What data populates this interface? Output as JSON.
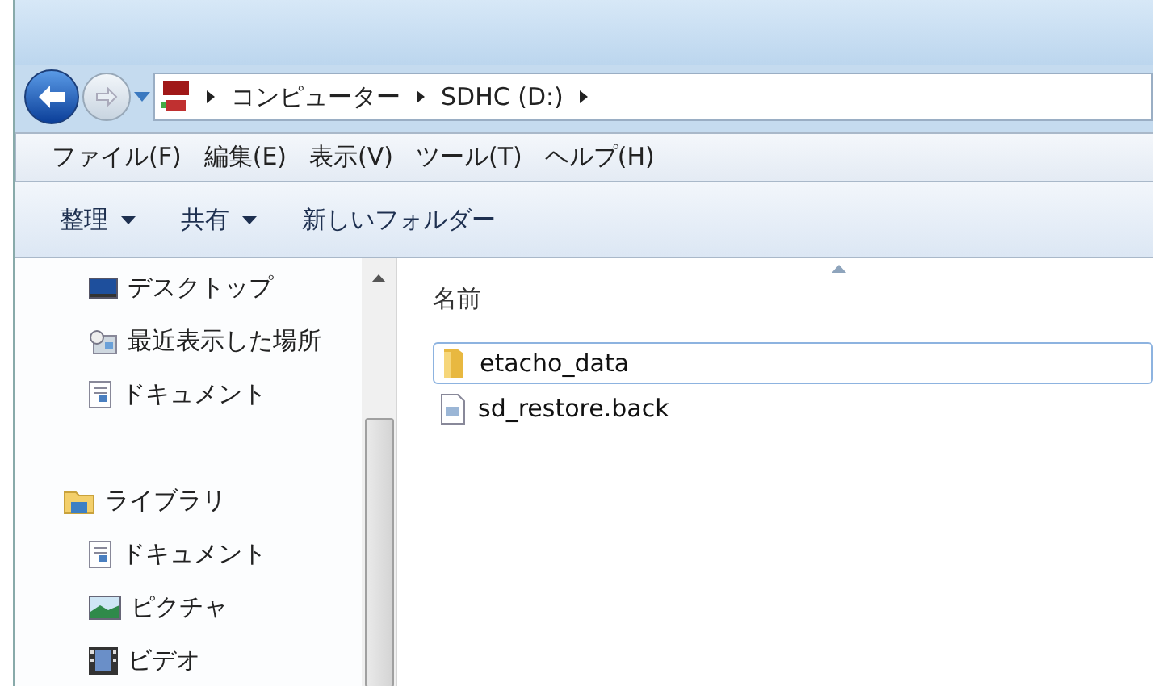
{
  "address_bar": {
    "crumbs": [
      "コンピューター",
      "SDHC (D:)"
    ]
  },
  "menu_bar": [
    "ファイル(F)",
    "編集(E)",
    "表示(V)",
    "ツール(T)",
    "ヘルプ(H)"
  ],
  "toolbar": [
    {
      "label": "整理",
      "dropdown": true
    },
    {
      "label": "共有",
      "dropdown": true
    },
    {
      "label": "新しいフォルダー",
      "dropdown": false
    }
  ],
  "nav_pane": [
    {
      "label": "デスクトップ",
      "kind": "desktop"
    },
    {
      "label": "最近表示した場所",
      "kind": "recent"
    },
    {
      "label": "ドキュメント",
      "kind": "document"
    },
    {
      "label": "ライブラリ",
      "kind": "library",
      "children": [
        {
          "label": "ドキュメント",
          "kind": "document"
        },
        {
          "label": "ピクチャ",
          "kind": "picture"
        },
        {
          "label": "ビデオ",
          "kind": "video"
        }
      ]
    }
  ],
  "file_list": {
    "column": "名前",
    "files": [
      {
        "name": "etacho_data",
        "kind": "folder",
        "selected": true
      },
      {
        "name": "sd_restore.back",
        "kind": "file",
        "selected": false
      }
    ]
  }
}
